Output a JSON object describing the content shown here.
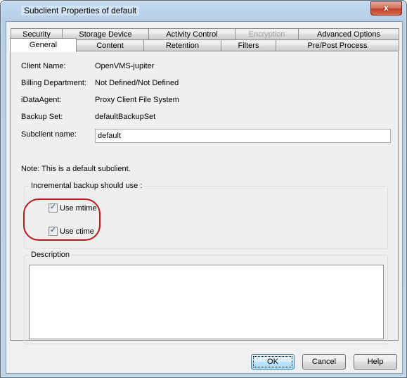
{
  "window": {
    "title": "Subclient Properties of default",
    "close_label": "x"
  },
  "tabs": {
    "back_row": [
      {
        "label": "Security",
        "disabled": false
      },
      {
        "label": "Storage Device",
        "disabled": false
      },
      {
        "label": "Activity Control",
        "disabled": false
      },
      {
        "label": "Encryption",
        "disabled": true
      },
      {
        "label": "Advanced Options",
        "disabled": false
      }
    ],
    "front_row": [
      {
        "label": "General",
        "active": true
      },
      {
        "label": "Content",
        "active": false
      },
      {
        "label": "Retention",
        "active": false
      },
      {
        "label": "Filters",
        "active": false
      },
      {
        "label": "Pre/Post Process",
        "active": false
      }
    ]
  },
  "general": {
    "fields": [
      {
        "label": "Client Name:",
        "value": "OpenVMS-jupiter"
      },
      {
        "label": "Billing Department:",
        "value": "Not Defined/Not Defined"
      },
      {
        "label": "iDataAgent:",
        "value": "Proxy Client File System"
      },
      {
        "label": "Backup Set:",
        "value": "defaultBackupSet"
      }
    ],
    "subclient_name_label": "Subclient name:",
    "subclient_name_value": "default",
    "note": "Note: This is a default subclient.",
    "incremental_group_label": "Incremental backup should use :",
    "checkboxes": [
      {
        "label": "Use mtime",
        "checked": true
      },
      {
        "label": "Use ctime",
        "checked": true
      }
    ],
    "description_label": "Description",
    "description_value": ""
  },
  "buttons": {
    "ok": "OK",
    "cancel": "Cancel",
    "help": "Help"
  },
  "annotation": {
    "highlight_color": "#b41a1a"
  }
}
